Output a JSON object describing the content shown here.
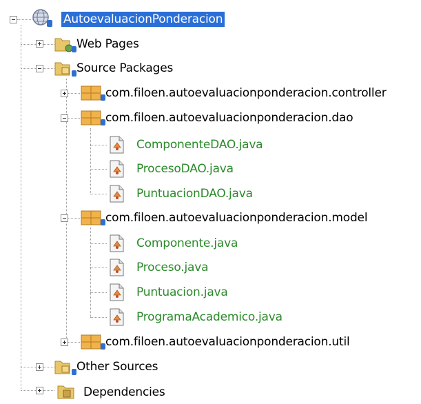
{
  "project": {
    "name": "AutoevaluacionPonderacion",
    "nodes": [
      {
        "label": "Web Pages",
        "kind": "folder-web",
        "expanded": false
      },
      {
        "label": "Source Packages",
        "kind": "folder-src",
        "expanded": true,
        "packages": [
          {
            "label": "com.filoen.autoevaluacionponderacion.controller",
            "expanded": false,
            "files": []
          },
          {
            "label": "com.filoen.autoevaluacionponderacion.dao",
            "expanded": true,
            "files": [
              "ComponenteDAO.java",
              "ProcesoDAO.java",
              "PuntuacionDAO.java"
            ]
          },
          {
            "label": "com.filoen.autoevaluacionponderacion.model",
            "expanded": true,
            "files": [
              "Componente.java",
              "Proceso.java",
              "Puntuacion.java",
              "ProgramaAcademico.java"
            ]
          },
          {
            "label": "com.filoen.autoevaluacionponderacion.util",
            "expanded": false,
            "files": []
          }
        ]
      },
      {
        "label": "Other Sources",
        "kind": "folder-other",
        "expanded": false
      },
      {
        "label": "Dependencies",
        "kind": "folder-deps",
        "expanded": false
      }
    ]
  },
  "colors": {
    "selection": "#2a6ed8",
    "file_text": "#2b8a2b",
    "package_orange": "#e8a33c",
    "badge_blue": "#2f6fd0"
  },
  "icons": {
    "project": "globe-project-icon",
    "folder": "folder-icon",
    "package": "package-icon",
    "java_file": "java-file-icon"
  }
}
